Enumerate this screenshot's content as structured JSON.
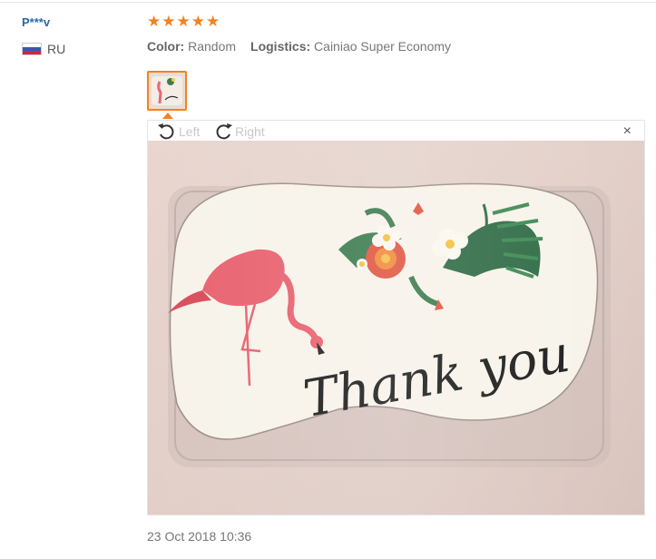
{
  "reviewer": {
    "name": "P***v",
    "country_code": "RU",
    "flag_colors": [
      "#ffffff",
      "#2e5bb8",
      "#d8262c"
    ]
  },
  "rating": {
    "stars": 5,
    "max": 5,
    "color": "#f5821f"
  },
  "details": {
    "color_label": "Color:",
    "color_value": "Random",
    "logistics_label": "Logistics:",
    "logistics_value": "Cainiao Super Economy"
  },
  "viewer": {
    "rotate_left_label": "Left",
    "rotate_right_label": "Right",
    "close_symbol": "×",
    "photo_caption": "Thank you"
  },
  "review_date": "23 Oct 2018 10:36",
  "colors": {
    "accent": "#f5821f",
    "link": "#2b67a8"
  }
}
